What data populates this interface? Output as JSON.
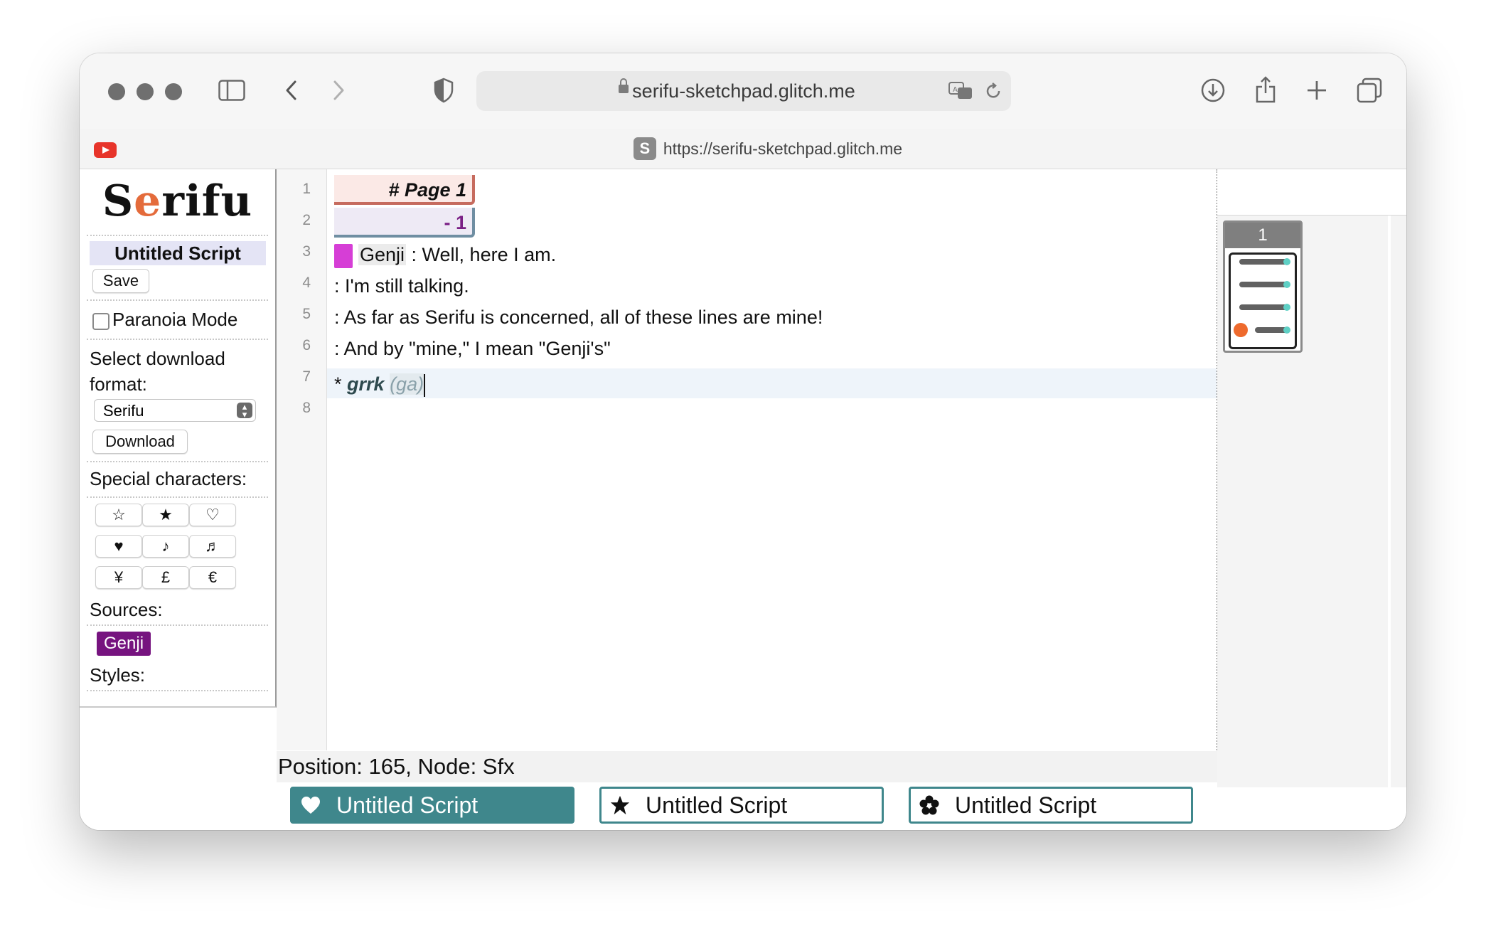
{
  "browser": {
    "url": "serifu-sketchpad.glitch.me",
    "tab_title": "https://serifu-sketchpad.glitch.me",
    "favicon_letter": "S"
  },
  "sidebar": {
    "logo": {
      "before": "S",
      "accent": "e",
      "after": "rifu"
    },
    "script_title": "Untitled Script",
    "save_label": "Save",
    "paranoia_label": "Paranoia Mode",
    "paranoia_checked": false,
    "download_format_label": "Select download format:",
    "download_format_value": "Serifu",
    "download_label": "Download",
    "special_chars_label": "Special characters:",
    "special_chars": [
      "☆",
      "★",
      "♡",
      "♥",
      "♪",
      "♬",
      "¥",
      "£",
      "€"
    ],
    "sources_label": "Sources:",
    "sources": [
      "Genji"
    ],
    "styles_label": "Styles:"
  },
  "editor": {
    "line_numbers": [
      "1",
      "2",
      "3",
      "4",
      "5",
      "6",
      "7",
      "8"
    ],
    "page_heading": "# Page 1",
    "panel_heading": "- 1",
    "speaker": "Genji",
    "line3_text": ": Well, here I am.",
    "line4_text": ": I'm still talking.",
    "line5_text": ": As far as Serifu is concerned, all of these lines are mine!",
    "line6_text": ": And by \"mine,\" I mean \"Genji's\"",
    "line7_marker": "* ",
    "line7_sfx": "grrk",
    "line7_note": "(ga)",
    "status": "Position: 165, Node: Sfx"
  },
  "script_tabs": [
    {
      "label": "Untitled Script",
      "icon": "heart-icon",
      "active": true
    },
    {
      "label": "Untitled Script",
      "icon": "star-icon",
      "active": false
    },
    {
      "label": "Untitled Script",
      "icon": "flower-icon",
      "active": false
    }
  ],
  "preview": {
    "page_number": "1"
  },
  "colors": {
    "accent": "#3f878c",
    "source_genji": "#76137f",
    "speaker_swatch": "#d63ed6",
    "page_heading_bg": "#fbe9e6",
    "panel_heading_bg": "#eeeaf5"
  }
}
